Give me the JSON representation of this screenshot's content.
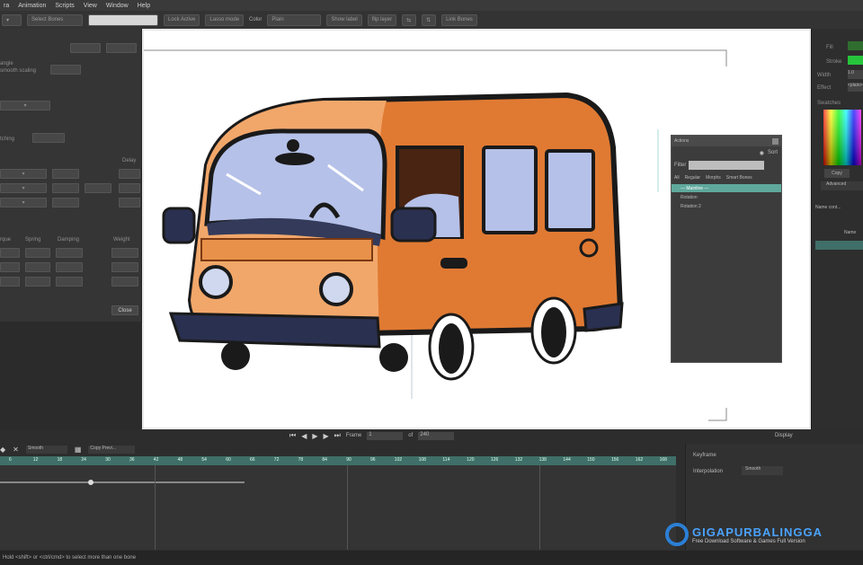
{
  "menu": [
    "ra",
    "Animation",
    "Scripts",
    "View",
    "Window",
    "Help"
  ],
  "toolbar": {
    "select_bones": "Select Bones",
    "lock_active": "Lock Active",
    "lasso_mode": "Lasso mode",
    "color_label": "Color",
    "color_value": "Plain",
    "show_label": "Show label",
    "flip_layer": "flip layer",
    "link_bones": "Link Bones"
  },
  "dialog": {
    "angle": "angle",
    "smooth_scaling": "smooth scaling",
    "stretching": "tching",
    "delay": "Delay",
    "torque": "rque",
    "spring": "Spring",
    "damping": "Damping",
    "weight": "Weight",
    "close": "Close"
  },
  "right_panel": {
    "fill": "Fill",
    "stroke": "Stroke",
    "width_label": "Width",
    "width_value": "1.0",
    "effect_label": "Effect",
    "effect_value": "<plain>",
    "swatches": "Swatches",
    "copy": "Copy",
    "advanced": "Advanced",
    "name_cont": "Name cont...",
    "name_col": "Name"
  },
  "actions": {
    "title": "Actions",
    "filter": "Filter",
    "sort": "Sort",
    "tabs": [
      "All",
      "Regular",
      "Morphs",
      "Smart Bones"
    ],
    "items": [
      "--- Mainline ---",
      "Rotation",
      "Rotation 2"
    ]
  },
  "timeline": {
    "smooth": "Smooth",
    "copy_prev": "Copy Previ...",
    "frame_label": "Frame",
    "frame_value": "1",
    "of_label": "of",
    "of_value": "240",
    "display": "Display",
    "ruler": [
      "6",
      "12",
      "18",
      "24",
      "30",
      "36",
      "42",
      "48",
      "54",
      "60",
      "66",
      "72",
      "78",
      "84",
      "90",
      "96",
      "102",
      "108",
      "114",
      "120",
      "126",
      "132",
      "138",
      "144",
      "150",
      "156",
      "162",
      "168"
    ]
  },
  "keys": {
    "keyframe": "Keyframe",
    "interpolation": "Interpolation",
    "interp_value": "Smooth"
  },
  "status": "Hold <shift> or <ctrl/cmd> to select more than one bone",
  "watermark": {
    "brand": "GIGAPURBALINGGA",
    "sub": "Free Download Software & Games Full Version"
  },
  "colors": {
    "van_body": "#e07a33",
    "van_light": "#f2a76a",
    "glass": "#b5c1e8",
    "accent": "#3f6f68"
  }
}
